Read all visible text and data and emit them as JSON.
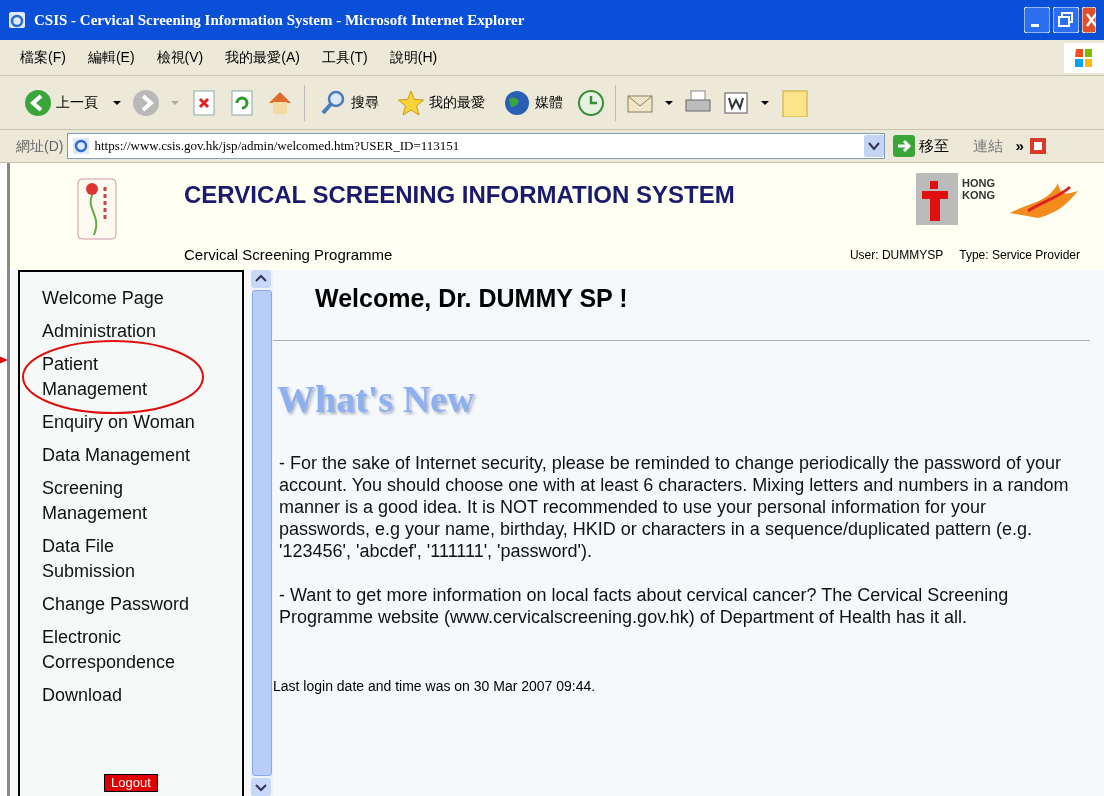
{
  "window": {
    "title": "CSIS - Cervical Screening Information System - Microsoft Internet Explorer"
  },
  "menu_bar": [
    "檔案(F)",
    "編輯(E)",
    "檢視(V)",
    "我的最愛(A)",
    "工具(T)",
    "說明(H)"
  ],
  "toolbar": [
    {
      "kind": "back",
      "label": "上一頁"
    },
    {
      "kind": "forward"
    },
    {
      "kind": "stop"
    },
    {
      "kind": "refresh"
    },
    {
      "kind": "home"
    },
    {
      "kind": "search",
      "label": "搜尋"
    },
    {
      "kind": "favorites",
      "label": "我的最愛"
    },
    {
      "kind": "media",
      "label": "媒體"
    },
    {
      "kind": "history"
    },
    {
      "kind": "mail"
    },
    {
      "kind": "print"
    },
    {
      "kind": "edit"
    },
    {
      "kind": "note"
    }
  ],
  "address_bar": {
    "label": "網址(D)",
    "url": "https://www.csis.gov.hk/jsp/admin/welcomed.htm?USER_ID=113151",
    "go": "移至",
    "links": "連結",
    "more": "»"
  },
  "header": {
    "title": "CERVICAL SCREENING INFORMATION SYSTEM",
    "subtitle": "Cervical Screening Programme",
    "user": "User: DUMMYSP",
    "type": "Type: Service Provider",
    "logo_text": "HONG KONG"
  },
  "sidebar": {
    "items": [
      {
        "label": "Welcome Page",
        "circled": false
      },
      {
        "label": "Administration",
        "circled": false
      },
      {
        "label": "Patient Management",
        "circled": true
      },
      {
        "label": "Enquiry on Woman",
        "circled": false
      },
      {
        "label": "Data Management",
        "circled": false
      },
      {
        "label": "Screening Management",
        "circled": false
      },
      {
        "label": "Data File Submission",
        "circled": false
      },
      {
        "label": "Change Password",
        "circled": false
      },
      {
        "label": "Electronic Correspondence",
        "circled": false
      },
      {
        "label": "Download",
        "circled": false
      }
    ],
    "logout": "Logout"
  },
  "content": {
    "greeting": "Welcome, Dr. DUMMY SP !",
    "heading": "What's New",
    "paragraphs": [
      "- For the sake of Internet security, please be reminded to change periodically the password of your account. You should choose one with at least 6 characters. Mixing letters and numbers in a random manner is a good idea. It is NOT recommended to use your personal information for your passwords, e.g your name, birthday, HKID or characters in a sequence/duplicated pattern (e.g. '123456', 'abcdef', '111111', 'password').",
      "- Want to get more information on local facts about cervical cancer? The Cervical Screening Programme website (www.cervicalscreening.gov.hk) of Department of Health has it all."
    ],
    "last_login": "Last login date and time was on 30 Mar 2007 09:44."
  }
}
